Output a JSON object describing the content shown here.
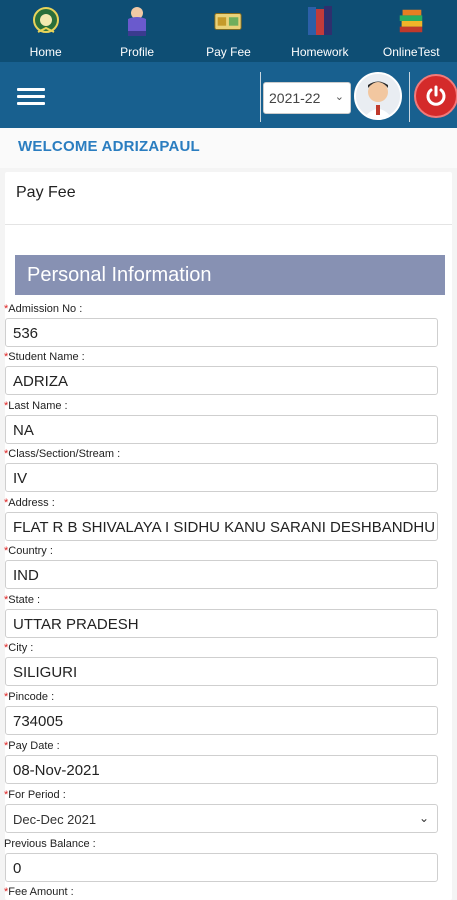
{
  "nav": {
    "items": [
      {
        "label": "Home",
        "icon": "school-logo-icon"
      },
      {
        "label": "Profile",
        "icon": "profile-person-icon"
      },
      {
        "label": "Pay Fee",
        "icon": "payment-icon"
      },
      {
        "label": "Homework",
        "icon": "books-icon"
      },
      {
        "label": "OnlineTest",
        "icon": "book-stack-icon"
      }
    ]
  },
  "appbar": {
    "session_value": "2021-22",
    "menu_icon": "hamburger-menu-icon",
    "power_icon": "power-icon"
  },
  "welcome": {
    "text": "WELCOME ADRIZAPAUL"
  },
  "page": {
    "title": "Pay Fee",
    "section_title": "Personal Information"
  },
  "fields": [
    {
      "label": "Admission No :",
      "value": "536",
      "required": "*"
    },
    {
      "label": "Student Name :",
      "value": "ADRIZA",
      "required": "*"
    },
    {
      "label": "Last Name :",
      "value": "NA",
      "required": "*"
    },
    {
      "label": "Class/Section/Stream :",
      "value": "IV",
      "required": "*"
    },
    {
      "label": "Address :",
      "value": "FLAT   R B SHIVALAYA    I SIDHU KANU SARANI DESHBANDHU PARA",
      "required": "*"
    },
    {
      "label": "Country :",
      "value": "IND",
      "required": "*"
    },
    {
      "label": "State :",
      "value": "UTTAR PRADESH",
      "required": "*"
    },
    {
      "label": "City :",
      "value": "SILIGURI",
      "required": "*"
    },
    {
      "label": "Pincode :",
      "value": "734005",
      "required": "*"
    },
    {
      "label": "Pay Date :",
      "value": "08-Nov-2021",
      "required": "*"
    },
    {
      "label": "For Period :",
      "value": "Dec-Dec 2021",
      "required": "*"
    },
    {
      "label": "Previous Balance :",
      "value": "0",
      "required": ""
    },
    {
      "label": "Fee Amount :",
      "value": "",
      "required": "*"
    }
  ],
  "colors": {
    "topnav": "#0e4e74",
    "appbar": "#18608f",
    "section": "#8791b3",
    "welcome_text": "#2a7dc0",
    "power": "#d42a2a"
  }
}
